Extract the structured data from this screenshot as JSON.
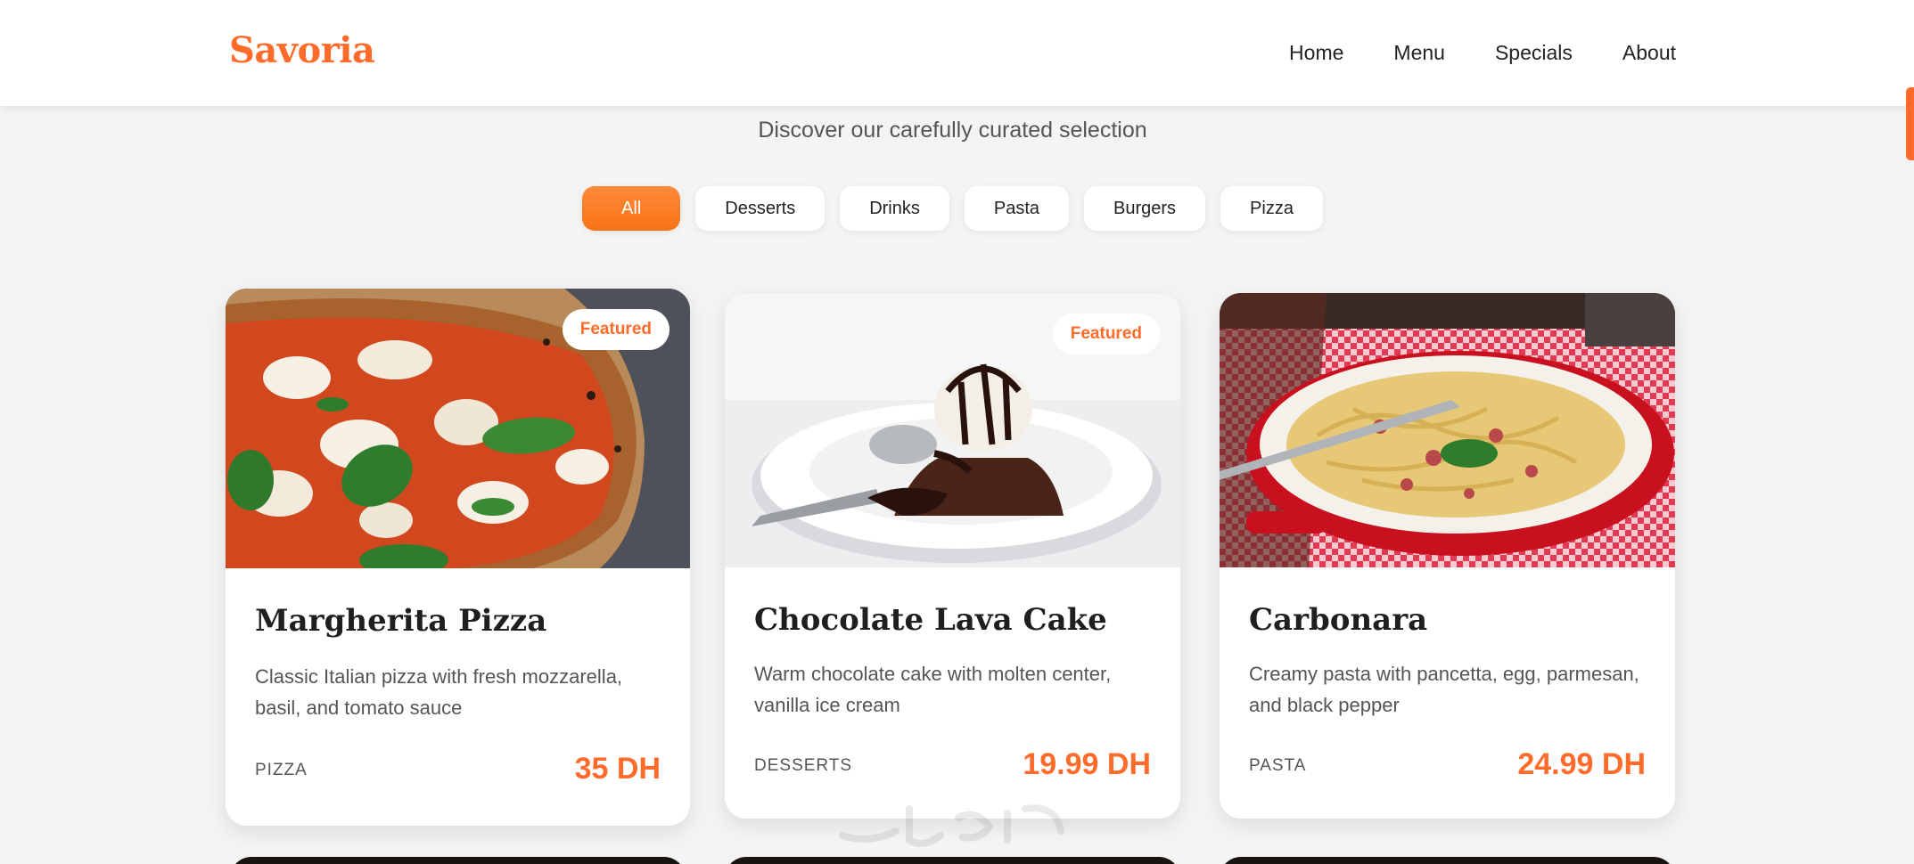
{
  "header": {
    "logo": "Savoria",
    "nav": [
      "Home",
      "Menu",
      "Specials",
      "About"
    ]
  },
  "page": {
    "subtitle": "Discover our carefully curated selection"
  },
  "filters": {
    "selected": "All",
    "options": [
      "All",
      "Desserts",
      "Drinks",
      "Pasta",
      "Burgers",
      "Pizza"
    ]
  },
  "cards": [
    {
      "title": "Margherita Pizza",
      "description": "Classic Italian pizza with fresh mozzarella, basil, and tomato sauce",
      "category": "PIZZA",
      "price": "35 DH",
      "badge": "Featured",
      "image": "margherita-pizza-photo"
    },
    {
      "title": "Chocolate Lava Cake",
      "description": "Warm chocolate cake with molten center, vanilla ice cream",
      "category": "DESSERTS",
      "price": "19.99 DH",
      "badge": "Featured",
      "image": "chocolate-lava-cake-photo"
    },
    {
      "title": "Carbonara",
      "description": "Creamy pasta with pancetta, egg, parmesan, and black pepper",
      "category": "PASTA",
      "price": "24.99 DH",
      "image": "carbonara-photo"
    }
  ],
  "colors": {
    "accent": "#ff6b2b",
    "background": "#f4f4f4",
    "card": "#ffffff"
  }
}
